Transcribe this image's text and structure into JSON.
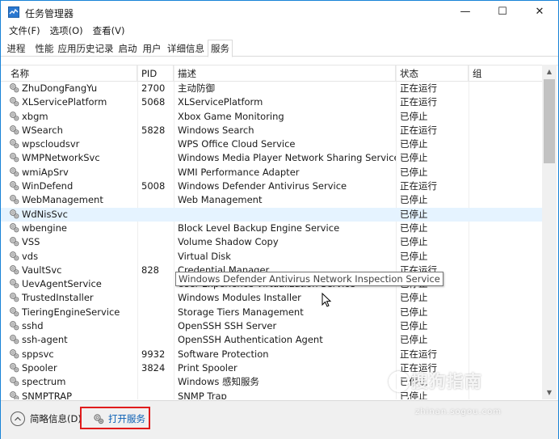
{
  "window": {
    "title": "任务管理器",
    "minimize_glyph": "—",
    "maximize_glyph": "☐",
    "close_glyph": "✕"
  },
  "menu": [
    "文件(F)",
    "选项(O)",
    "查看(V)"
  ],
  "tabs": [
    "进程",
    "性能",
    "应用历史记录",
    "启动",
    "用户",
    "详细信息",
    "服务"
  ],
  "active_tab": "服务",
  "columns": {
    "name": "名称",
    "pid": "PID",
    "description": "描述",
    "status": "状态",
    "group": "组"
  },
  "rows": [
    {
      "name": "ZhuDongFangYu",
      "pid": "2700",
      "description": "主动防御",
      "status": "正在运行"
    },
    {
      "name": "XLServicePlatform",
      "pid": "5068",
      "description": "XLServicePlatform",
      "status": "正在运行"
    },
    {
      "name": "xbgm",
      "pid": "",
      "description": "Xbox Game Monitoring",
      "status": "已停止"
    },
    {
      "name": "WSearch",
      "pid": "5828",
      "description": "Windows Search",
      "status": "正在运行"
    },
    {
      "name": "wpscloudsvr",
      "pid": "",
      "description": "WPS Office Cloud Service",
      "status": "已停止"
    },
    {
      "name": "WMPNetworkSvc",
      "pid": "",
      "description": "Windows Media Player Network Sharing Service",
      "status": "已停止"
    },
    {
      "name": "wmiApSrv",
      "pid": "",
      "description": "WMI Performance Adapter",
      "status": "已停止"
    },
    {
      "name": "WinDefend",
      "pid": "5008",
      "description": "Windows Defender Antivirus Service",
      "status": "正在运行"
    },
    {
      "name": "WebManagement",
      "pid": "",
      "description": "Web Management",
      "status": "已停止"
    },
    {
      "name": "WdNisSvc",
      "pid": "",
      "description": "",
      "status": "已停止"
    },
    {
      "name": "wbengine",
      "pid": "",
      "description": "Block Level Backup Engine Service",
      "status": "已停止"
    },
    {
      "name": "VSS",
      "pid": "",
      "description": "Volume Shadow Copy",
      "status": "已停止"
    },
    {
      "name": "vds",
      "pid": "",
      "description": "Virtual Disk",
      "status": "已停止"
    },
    {
      "name": "VaultSvc",
      "pid": "828",
      "description": "Credential Manager",
      "status": "正在运行"
    },
    {
      "name": "UevAgentService",
      "pid": "",
      "description": "User Experience Virtualization Service",
      "status": "已停止"
    },
    {
      "name": "TrustedInstaller",
      "pid": "",
      "description": "Windows Modules Installer",
      "status": "已停止"
    },
    {
      "name": "TieringEngineService",
      "pid": "",
      "description": "Storage Tiers Management",
      "status": "已停止"
    },
    {
      "name": "sshd",
      "pid": "",
      "description": "OpenSSH SSH Server",
      "status": "已停止"
    },
    {
      "name": "ssh-agent",
      "pid": "",
      "description": "OpenSSH Authentication Agent",
      "status": "已停止"
    },
    {
      "name": "sppsvc",
      "pid": "9932",
      "description": "Software Protection",
      "status": "正在运行"
    },
    {
      "name": "Spooler",
      "pid": "3824",
      "description": "Print Spooler",
      "status": "正在运行"
    },
    {
      "name": "spectrum",
      "pid": "",
      "description": "Windows 感知服务",
      "status": "已停止"
    },
    {
      "name": "SNMPTRAP",
      "pid": "",
      "description": "SNMP Trap",
      "status": "已停止"
    }
  ],
  "tooltip": "Windows Defender Antivirus Network Inspection Service",
  "footer": {
    "fewer_details": "简略信息(D)",
    "open_services": "打开服务"
  },
  "watermark": {
    "text": "搜狗指南",
    "sub": "zhinan.sogou.com"
  },
  "colors": {
    "window_border": "#1883d7",
    "hover_row": "#e5f3ff",
    "highlight_box": "#e01b1b",
    "link": "#0a5fb4"
  },
  "icons": {
    "app": "task-manager-icon",
    "service": "gear-service-icon",
    "fewer_details": "chevron-up-circle-icon",
    "open_services": "services-gear-icon"
  }
}
